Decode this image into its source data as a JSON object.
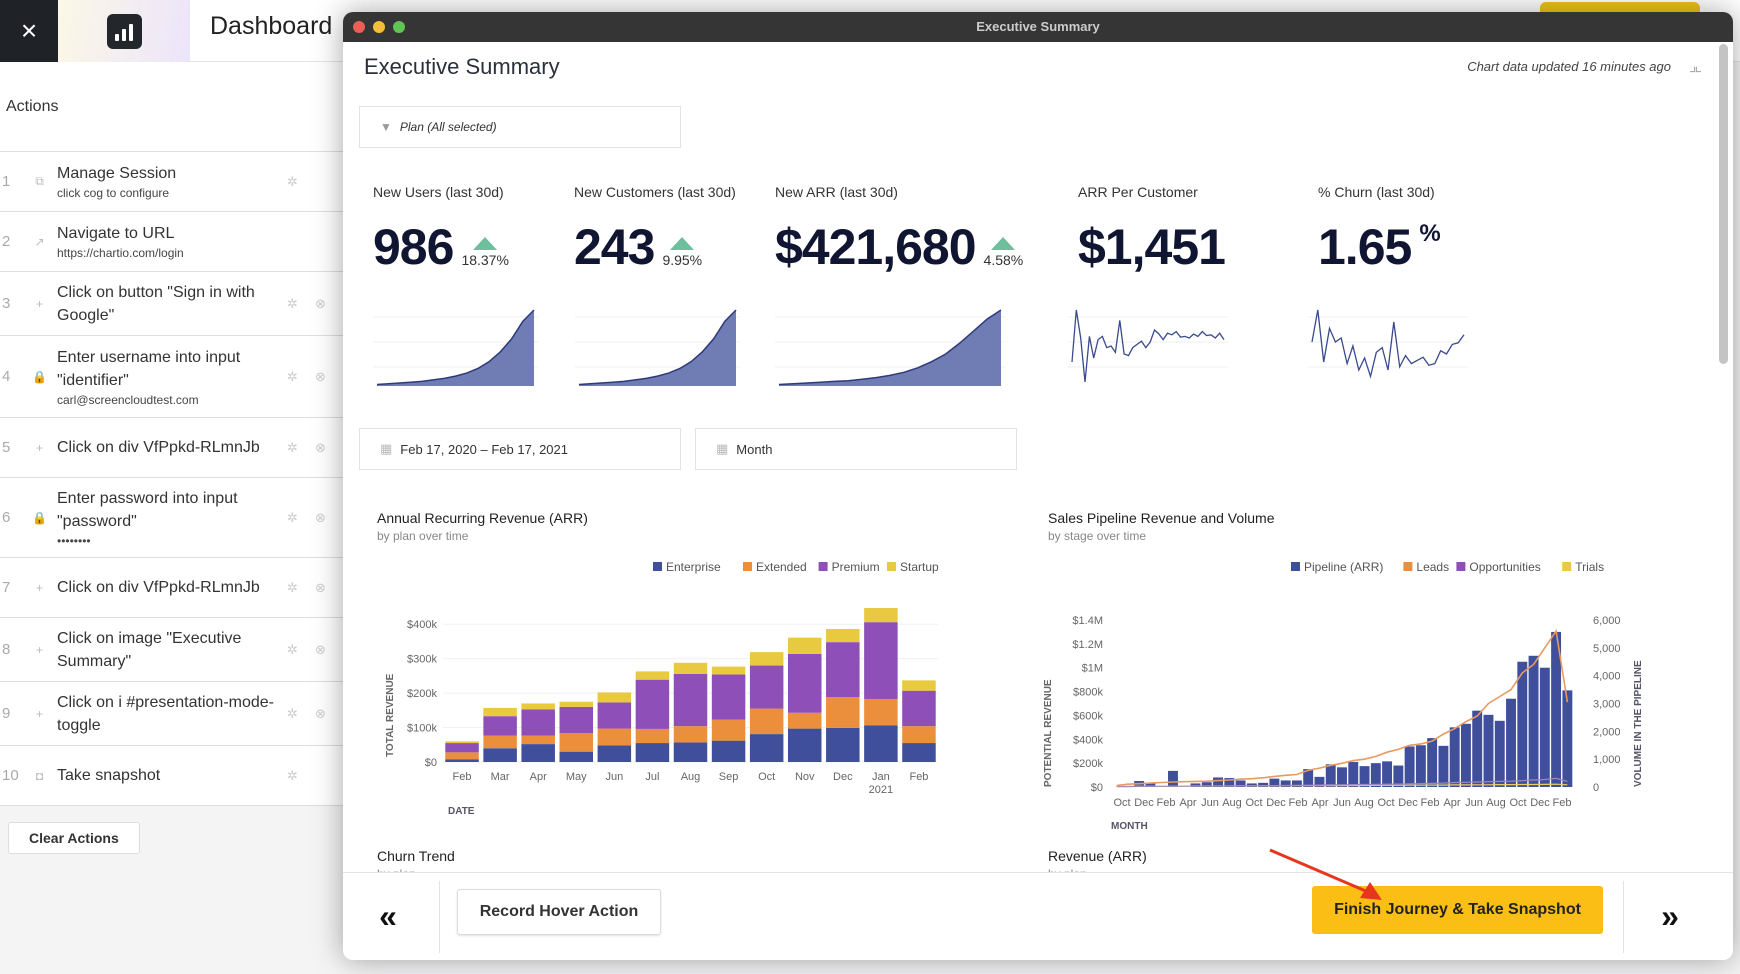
{
  "topbar": {
    "close_icon": "×",
    "app_title": "Dashboard"
  },
  "actions": {
    "heading": "Actions",
    "items": [
      {
        "num": "1",
        "icon": "session-icon",
        "glyph": "⧉",
        "label": "Manage Session",
        "sub": "click cog to configure",
        "gear": true,
        "remove": false
      },
      {
        "num": "2",
        "icon": "external-link-icon",
        "glyph": "↗",
        "label": "Navigate to URL",
        "sub": "https://chartio.com/login",
        "gear": false,
        "remove": false
      },
      {
        "num": "3",
        "icon": "click-icon",
        "glyph": "+",
        "label": "Click on button \"Sign in with Google\"",
        "sub": "",
        "gear": true,
        "remove": true
      },
      {
        "num": "4",
        "icon": "lock-icon",
        "glyph": "🔒",
        "label": "Enter username into input \"identifier\"",
        "sub": "carl@screencloudtest.com",
        "gear": true,
        "remove": true
      },
      {
        "num": "5",
        "icon": "click-icon",
        "glyph": "+",
        "label": "Click on div VfPpkd-RLmnJb",
        "sub": "",
        "gear": true,
        "remove": true
      },
      {
        "num": "6",
        "icon": "lock-icon",
        "glyph": "🔒",
        "label": "Enter password into input \"password\"",
        "sub": "••••••••",
        "gear": true,
        "remove": true
      },
      {
        "num": "7",
        "icon": "click-icon",
        "glyph": "+",
        "label": "Click on div VfPpkd-RLmnJb",
        "sub": "",
        "gear": true,
        "remove": true
      },
      {
        "num": "8",
        "icon": "click-icon",
        "glyph": "+",
        "label": "Click on image \"Executive Summary\"",
        "sub": "",
        "gear": true,
        "remove": true
      },
      {
        "num": "9",
        "icon": "click-icon",
        "glyph": "+",
        "label": "Click on i #presentation-mode-toggle",
        "sub": "",
        "gear": true,
        "remove": true
      },
      {
        "num": "10",
        "icon": "camera-icon",
        "glyph": "◘",
        "label": "Take snapshot",
        "sub": "",
        "gear": true,
        "remove": false
      }
    ],
    "clear_label": "Clear Actions"
  },
  "window": {
    "title": "Executive Summary",
    "page_title": "Executive Summary",
    "updated": "Chart data updated 16 minutes ago",
    "filter_label": "Plan (All selected)",
    "date_range": "Feb 17, 2020  –  Feb 17, 2021",
    "granularity": "Month"
  },
  "kpis": [
    {
      "label": "New Users (last 30d)",
      "value": "986",
      "delta": "18.37%",
      "trend": "up"
    },
    {
      "label": "New Customers (last 30d)",
      "value": "243",
      "delta": "9.95%",
      "trend": "up"
    },
    {
      "label": "New ARR (last 30d)",
      "value": "$421,680",
      "delta": "4.58%",
      "trend": "up"
    },
    {
      "label": "ARR Per Customer",
      "value": "$1,451",
      "delta": "",
      "trend": ""
    },
    {
      "label": "% Churn (last 30d)",
      "value": "1.65",
      "suffix": "%",
      "delta": "",
      "trend": ""
    }
  ],
  "colors": {
    "enterprise": "#3f4f9c",
    "extended": "#ec8f3d",
    "premium": "#8e4fb8",
    "startup": "#e9c93f",
    "pipeline": "#3f4f9c",
    "leads": "#ec8f3d",
    "opportunities": "#8e4fb8",
    "trials": "#e9c93f",
    "accent": "#fbbe14",
    "up": "#6dbf9e"
  },
  "chart_data": [
    {
      "type": "bar",
      "stacked": true,
      "title": "Annual Recurring Revenue (ARR)",
      "subtitle": "by plan over time",
      "xlabel": "DATE",
      "ylabel": "TOTAL REVENUE",
      "categories": [
        "Feb",
        "Mar",
        "Apr",
        "May",
        "Jun",
        "Jul",
        "Aug",
        "Sep",
        "Oct",
        "Nov",
        "Dec",
        "Jan\n2021",
        "Feb"
      ],
      "yticks": [
        "$0",
        "$100k",
        "$200k",
        "$300k",
        "$400k"
      ],
      "ylim": [
        0,
        450000
      ],
      "legend": "top-right",
      "series": [
        {
          "name": "Enterprise",
          "values": [
            8000,
            40000,
            52000,
            30000,
            48000,
            55000,
            57000,
            62000,
            81000,
            97000,
            99000,
            106000,
            55000
          ]
        },
        {
          "name": "Extended",
          "values": [
            20000,
            37000,
            25000,
            54000,
            49000,
            41000,
            47000,
            61000,
            74000,
            46000,
            89000,
            77000,
            49000
          ]
        },
        {
          "name": "Premium",
          "values": [
            27000,
            56000,
            76000,
            76000,
            76000,
            143000,
            152000,
            131000,
            125000,
            171000,
            160000,
            223000,
            103000
          ]
        },
        {
          "name": "Startup",
          "values": [
            5000,
            24000,
            17000,
            15000,
            29000,
            24000,
            32000,
            23000,
            39000,
            47000,
            38000,
            41000,
            30000
          ]
        }
      ]
    },
    {
      "type": "bar",
      "title": "Sales Pipeline Revenue and Volume",
      "subtitle": "by stage over time",
      "xlabel": "MONTH",
      "ylabel": "POTENTIAL REVENUE",
      "y2label": "VOLUME IN THE PIPELINE",
      "xticks": [
        "Oct",
        "Dec",
        "Feb",
        "Apr",
        "Jun",
        "Aug",
        "Oct",
        "Dec",
        "Feb",
        "Apr",
        "Jun",
        "Aug",
        "Oct",
        "Dec",
        "Feb",
        "Apr",
        "Jun",
        "Aug",
        "Oct",
        "Dec",
        "Feb"
      ],
      "yticks": [
        "$0",
        "$200k",
        "$400k",
        "$600k",
        "$800k",
        "$1M",
        "$1.2M",
        "$1.4M"
      ],
      "y2ticks": [
        "0",
        "1,000",
        "2,000",
        "3,000",
        "4,000",
        "5,000",
        "6,000"
      ],
      "ylim": [
        0,
        1400000
      ],
      "y2lim": [
        0,
        6000
      ],
      "legend": "top-right",
      "series": [
        {
          "name": "Pipeline (ARR)",
          "kind": "bar",
          "axis": "left",
          "values": [
            0,
            5000,
            50000,
            30000,
            0,
            135000,
            0,
            30000,
            40000,
            80000,
            75000,
            55000,
            30000,
            35000,
            70000,
            55000,
            55000,
            150000,
            85000,
            190000,
            165000,
            210000,
            175000,
            200000,
            215000,
            180000,
            340000,
            350000,
            410000,
            345000,
            500000,
            530000,
            640000,
            605000,
            555000,
            740000,
            1050000,
            1100000,
            1000000,
            1300000,
            810000
          ]
        },
        {
          "name": "Leads",
          "kind": "line",
          "axis": "right",
          "values": [
            50,
            100,
            120,
            140,
            160,
            180,
            190,
            200,
            210,
            230,
            250,
            280,
            300,
            330,
            380,
            420,
            450,
            600,
            680,
            780,
            850,
            950,
            1000,
            1100,
            1250,
            1350,
            1500,
            1550,
            1650,
            1900,
            2100,
            2350,
            2550,
            3000,
            3250,
            3500,
            4100,
            4400,
            5000,
            5600,
            3050
          ]
        },
        {
          "name": "Opportunities",
          "kind": "line",
          "axis": "right",
          "values": [
            10,
            15,
            20,
            20,
            25,
            25,
            30,
            30,
            35,
            35,
            40,
            40,
            45,
            45,
            50,
            55,
            60,
            65,
            70,
            75,
            80,
            85,
            90,
            95,
            100,
            105,
            110,
            120,
            130,
            140,
            160,
            170,
            180,
            190,
            200,
            210,
            230,
            250,
            270,
            310,
            200
          ]
        },
        {
          "name": "Trials",
          "kind": "line",
          "axis": "right",
          "values": [
            20,
            25,
            30,
            30,
            30,
            30,
            30,
            35,
            35,
            35,
            35,
            40,
            40,
            40,
            40,
            45,
            45,
            45,
            50,
            50,
            50,
            55,
            55,
            60,
            60,
            60,
            65,
            65,
            70,
            70,
            75,
            75,
            80,
            80,
            85,
            85,
            90,
            90,
            95,
            100,
            80
          ]
        }
      ]
    },
    {
      "type": "area",
      "title": "New Users sparkline",
      "values": [
        2,
        3,
        4,
        5,
        6,
        8,
        10,
        13,
        17,
        23,
        32,
        45,
        62,
        85,
        100
      ]
    },
    {
      "type": "area",
      "title": "New Customers sparkline",
      "values": [
        2,
        3,
        4,
        5,
        6,
        8,
        10,
        13,
        17,
        23,
        32,
        45,
        62,
        85,
        100
      ]
    },
    {
      "type": "area",
      "title": "New ARR sparkline",
      "values": [
        2,
        3,
        4,
        5,
        6,
        7,
        9,
        11,
        14,
        18,
        24,
        32,
        42,
        56,
        72,
        88,
        100
      ]
    },
    {
      "type": "line",
      "title": "ARR Per Customer sparkline",
      "values": [
        30,
        95,
        60,
        5,
        62,
        35,
        58,
        62,
        48,
        50,
        42,
        82,
        40,
        38,
        48,
        52,
        56,
        48,
        55,
        70,
        65,
        58,
        66,
        64,
        68,
        61,
        62,
        60,
        65,
        62,
        68,
        63,
        64,
        60,
        66,
        58
      ]
    },
    {
      "type": "line",
      "title": "% Churn sparkline",
      "values": [
        55,
        95,
        30,
        72,
        55,
        60,
        28,
        50,
        20,
        35,
        12,
        42,
        48,
        20,
        80,
        24,
        38,
        28,
        32,
        36,
        26,
        28,
        44,
        40,
        52,
        54,
        64
      ]
    }
  ],
  "lower_charts": [
    {
      "title": "Churn Trend",
      "subtitle": "by plan"
    },
    {
      "title": "Revenue (ARR)",
      "subtitle": "by plan"
    }
  ],
  "footer": {
    "prev_label": "«",
    "hover_label": "Record Hover Action",
    "finish_label": "Finish Journey & Take Snapshot",
    "next_label": "»"
  }
}
